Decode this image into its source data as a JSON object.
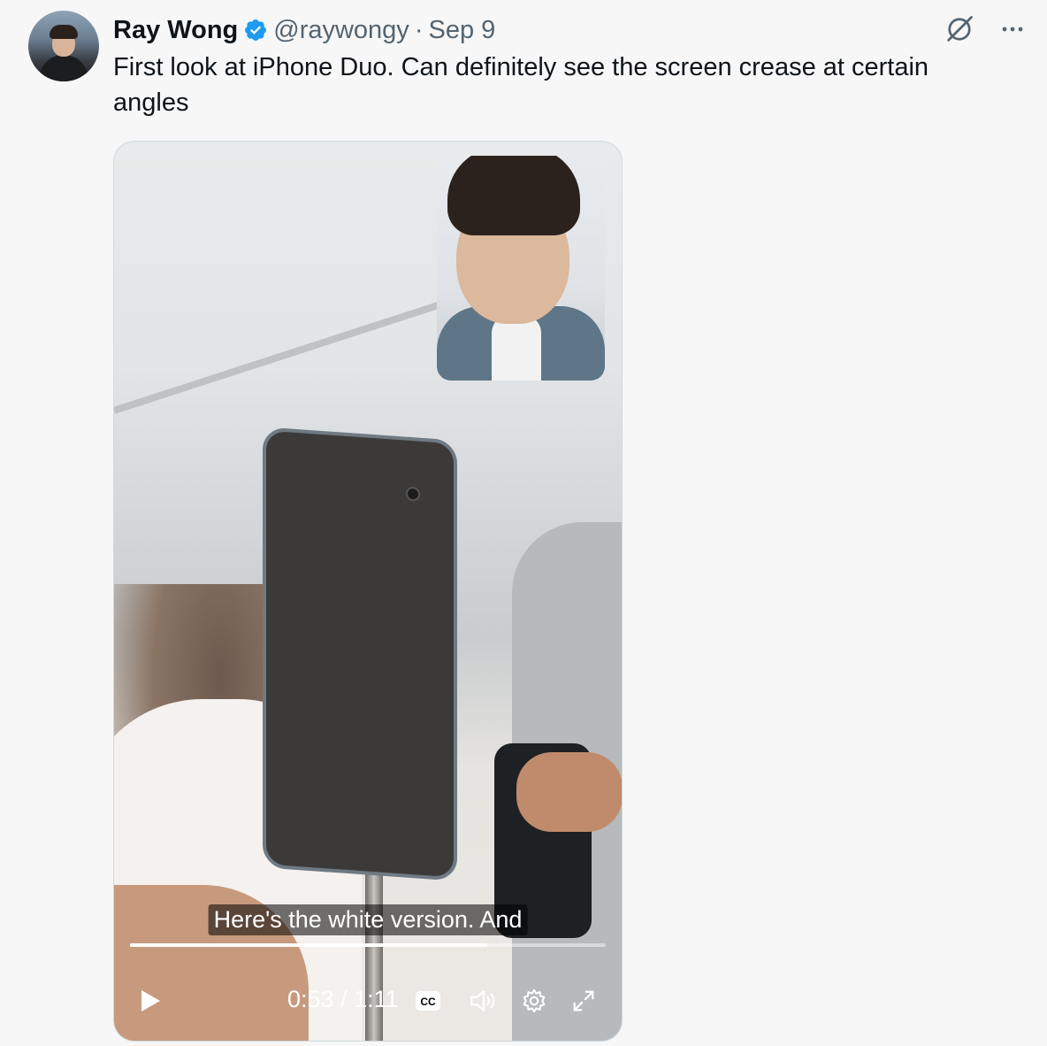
{
  "tweet": {
    "author_name": "Ray Wong",
    "handle": "@raywongy",
    "separator": "·",
    "date": "Sep 9",
    "text": "First look at iPhone Duo. Can definitely see the screen crease at certain angles"
  },
  "actions": {
    "grok_icon": "grok-icon",
    "more_icon": "more-icon"
  },
  "video": {
    "caption": "Here's the white version. And",
    "current_time": "0:53",
    "time_separator": " / ",
    "duration": "1:11",
    "progress": 0.75,
    "cc_label": "CC"
  },
  "colors": {
    "verified": "#1d9bf0",
    "text_primary": "#0f1419",
    "text_secondary": "#536471"
  }
}
